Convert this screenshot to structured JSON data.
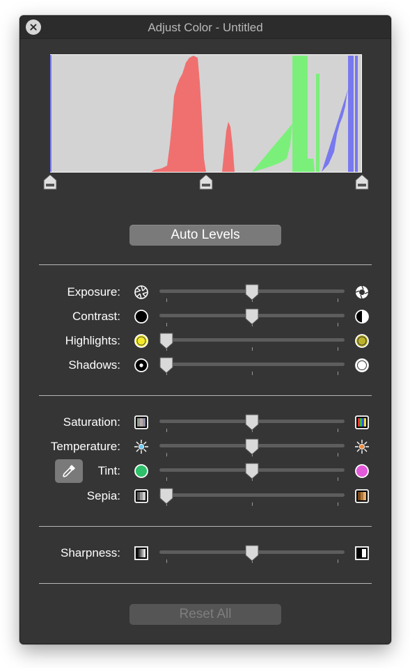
{
  "window": {
    "title": "Adjust Color - Untitled"
  },
  "buttons": {
    "auto_levels": "Auto Levels",
    "reset_all": "Reset All"
  },
  "levels": {
    "black_point": 0.0,
    "midpoint": 0.5,
    "white_point": 1.0
  },
  "adjustments": [
    {
      "key": "exposure",
      "label": "Exposure:",
      "value": 0.5,
      "min_icon": "aperture-closed-icon",
      "max_icon": "aperture-open-icon"
    },
    {
      "key": "contrast",
      "label": "Contrast:",
      "value": 0.5,
      "min_icon": "black-circle-icon",
      "max_icon": "half-circle-icon"
    },
    {
      "key": "highlights",
      "label": "Highlights:",
      "value": 0.0,
      "min_icon": "yellow-circle-icon",
      "max_icon": "dark-yellow-circle-icon"
    },
    {
      "key": "shadows",
      "label": "Shadows:",
      "value": 0.0,
      "min_icon": "dot-circle-icon",
      "max_icon": "white-circle-icon"
    },
    {
      "key": "saturation",
      "label": "Saturation:",
      "value": 0.5,
      "min_icon": "desaturated-swatch-icon",
      "max_icon": "color-swatch-icon"
    },
    {
      "key": "temperature",
      "label": "Temperature:",
      "value": 0.5,
      "min_icon": "cool-sun-icon",
      "max_icon": "warm-sun-icon"
    },
    {
      "key": "tint",
      "label": "Tint:",
      "value": 0.5,
      "min_icon": "green-circle-icon",
      "max_icon": "magenta-circle-icon"
    },
    {
      "key": "sepia",
      "label": "Sepia:",
      "value": 0.0,
      "min_icon": "gray-swatch-icon",
      "max_icon": "sepia-swatch-icon"
    },
    {
      "key": "sharpness",
      "label": "Sharpness:",
      "value": 0.5,
      "min_icon": "soft-edge-icon",
      "max_icon": "sharp-edge-icon"
    }
  ],
  "colors": {
    "histogram_bg": "#d3d3d3",
    "red": "#f07070",
    "green": "#7af07a",
    "blue": "#7878f0"
  }
}
